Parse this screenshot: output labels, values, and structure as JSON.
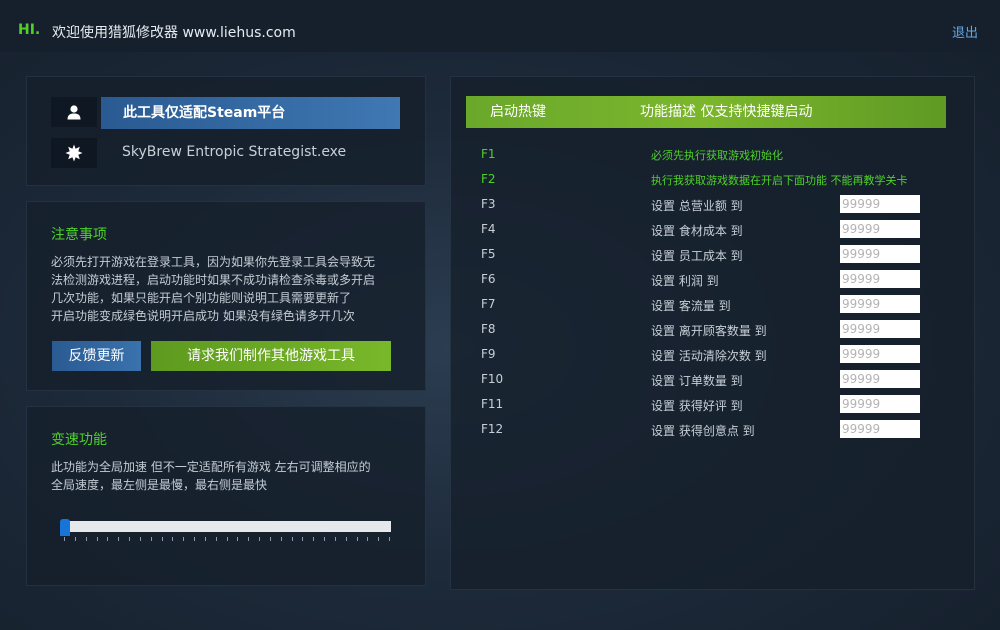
{
  "header": {
    "hi": "HI.",
    "title": "欢迎使用猎狐修改器 www.liehus.com",
    "logout": "退出"
  },
  "info": {
    "banner": "此工具仅适配Steam平台",
    "exe": "SkyBrew Entropic Strategist.exe",
    "user_icon": "user-icon",
    "gear_icon": "gear-icon"
  },
  "notes": {
    "title": "注意事项",
    "lines": [
      "必须先打开游戏在登录工具，因为如果你先登录工具会导致无",
      "法检测游戏进程，启动功能时如果不成功请检查杀毒或多开启",
      "几次功能，如果只能开启个别功能则说明工具需要更新了",
      "开启功能变成绿色说明开启成功 如果没有绿色请多开几次"
    ],
    "feedback_button": "反馈更新",
    "request_button": "请求我们制作其他游戏工具"
  },
  "speed": {
    "title": "变速功能",
    "lines": [
      "此功能为全局加速 但不一定适配所有游戏 左右可调整相应的",
      "全局速度，最左侧是最慢，最右侧是最快"
    ],
    "slider_value": 0
  },
  "hotkeys": {
    "col_key": "启动热键",
    "col_desc": "功能描述 仅支持快捷键启动",
    "rows": [
      {
        "key": "F1",
        "desc": "必须先执行获取游戏初始化",
        "input": false,
        "active": true
      },
      {
        "key": "F2",
        "desc": "执行我获取游戏数据在开启下面功能 不能再教学关卡",
        "input": false,
        "active": true
      },
      {
        "key": "F3",
        "desc": "设置 总营业额 到",
        "input": true,
        "placeholder": "99999"
      },
      {
        "key": "F4",
        "desc": "设置 食材成本 到",
        "input": true,
        "placeholder": "99999"
      },
      {
        "key": "F5",
        "desc": "设置 员工成本 到",
        "input": true,
        "placeholder": "99999"
      },
      {
        "key": "F6",
        "desc": "设置 利润 到",
        "input": true,
        "placeholder": "99999"
      },
      {
        "key": "F7",
        "desc": "设置 客流量 到",
        "input": true,
        "placeholder": "99999"
      },
      {
        "key": "F8",
        "desc": "设置 离开顾客数量 到",
        "input": true,
        "placeholder": "99999"
      },
      {
        "key": "F9",
        "desc": "设置 活动清除次数 到",
        "input": true,
        "placeholder": "99999"
      },
      {
        "key": "F10",
        "desc": "设置 订单数量 到",
        "input": true,
        "placeholder": "99999"
      },
      {
        "key": "F11",
        "desc": "设置 获得好评 到",
        "input": true,
        "placeholder": "99999"
      },
      {
        "key": "F12",
        "desc": "设置 获得创意点 到",
        "input": true,
        "placeholder": "99999"
      }
    ]
  }
}
